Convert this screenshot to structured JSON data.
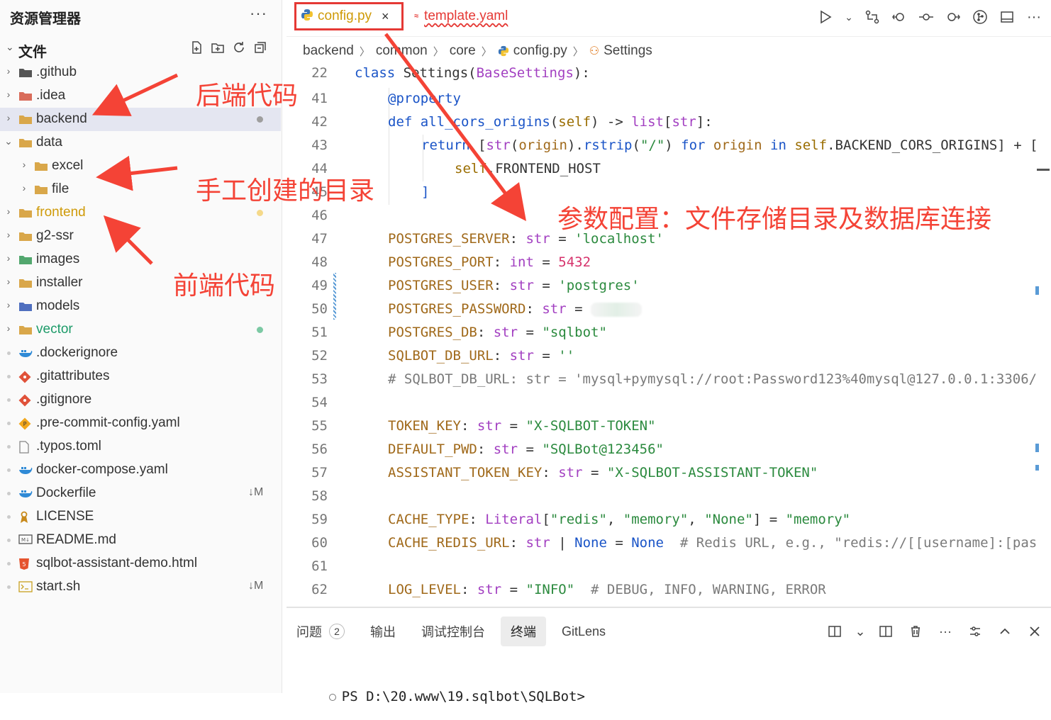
{
  "sidebar": {
    "title": "资源管理器",
    "more": "···",
    "section_title": "文件",
    "items": [
      {
        "label": "github",
        "prefix": ".",
        "kind": "folder",
        "depth": 0,
        "expanded": false,
        "color": "#333"
      },
      {
        "label": "idea",
        "prefix": ".",
        "kind": "folder",
        "depth": 0,
        "expanded": false
      },
      {
        "label": "backend",
        "kind": "folder",
        "depth": 0,
        "expanded": false,
        "selected": true,
        "dot": "#9e9e9e"
      },
      {
        "label": "data",
        "kind": "folder",
        "depth": 0,
        "expanded": true
      },
      {
        "label": "excel",
        "kind": "folder",
        "depth": 1,
        "expanded": false
      },
      {
        "label": "file",
        "kind": "folder",
        "depth": 1,
        "expanded": false
      },
      {
        "label": "frontend",
        "kind": "folder",
        "depth": 0,
        "expanded": false,
        "dot": "#f5d98a"
      },
      {
        "label": "g2-ssr",
        "kind": "folder",
        "depth": 0,
        "expanded": false
      },
      {
        "label": "images",
        "kind": "folder",
        "depth": 0,
        "expanded": false
      },
      {
        "label": "installer",
        "kind": "folder",
        "depth": 0,
        "expanded": false
      },
      {
        "label": "models",
        "kind": "folder",
        "depth": 0,
        "expanded": false
      },
      {
        "label": "vector",
        "kind": "folder",
        "depth": 0,
        "expanded": false,
        "dot": "#7cc9a4"
      },
      {
        "label": ".dockerignore",
        "kind": "docker"
      },
      {
        "label": ".gitattributes",
        "kind": "git"
      },
      {
        "label": ".gitignore",
        "kind": "git"
      },
      {
        "label": ".pre-commit-config.yaml",
        "kind": "precommit"
      },
      {
        "label": ".typos.toml",
        "kind": "file"
      },
      {
        "label": "docker-compose.yaml",
        "kind": "docker"
      },
      {
        "label": "Dockerfile",
        "kind": "docker",
        "badge": "↓M"
      },
      {
        "label": "LICENSE",
        "kind": "license"
      },
      {
        "label": "README.md",
        "kind": "md"
      },
      {
        "label": "sqlbot-assistant-demo.html",
        "kind": "html"
      },
      {
        "label": "start.sh",
        "kind": "sh",
        "badge": "↓M"
      }
    ]
  },
  "tabs": {
    "active": {
      "label": "config.py",
      "close": "×"
    },
    "second": {
      "label": "template.yaml"
    }
  },
  "breadcrumb": [
    "backend",
    "common",
    "core",
    "config.py",
    "Settings"
  ],
  "code": {
    "lines": [
      {
        "n": "22",
        "parts": [
          [
            "kw",
            "class "
          ],
          [
            "",
            "Settings"
          ],
          [
            "",
            "("
          ],
          [
            "ty",
            "BaseSettings"
          ],
          [
            "",
            "):"
          ]
        ]
      },
      {
        "n": "41",
        "indent": 1,
        "parts": [
          [
            "dec",
            "@property"
          ]
        ]
      },
      {
        "n": "42",
        "indent": 1,
        "parts": [
          [
            "kw",
            "def "
          ],
          [
            "fn",
            "all_cors_origins"
          ],
          [
            "",
            "("
          ],
          [
            "self",
            "self"
          ],
          [
            "",
            ") -> "
          ],
          [
            "ty",
            "list"
          ],
          [
            "",
            "["
          ],
          [
            "ty",
            "str"
          ],
          [
            "",
            "]:"
          ]
        ]
      },
      {
        "n": "43",
        "indent": 2,
        "parts": [
          [
            "kw",
            "return "
          ],
          [
            "",
            "["
          ],
          [
            "ty",
            "str"
          ],
          [
            "",
            "("
          ],
          [
            "var",
            "origin"
          ],
          [
            "",
            ")."
          ],
          [
            "fn",
            "rstrip"
          ],
          [
            "",
            "("
          ],
          [
            "str",
            "\"/\""
          ],
          [
            "",
            ") "
          ],
          [
            "kw",
            "for "
          ],
          [
            "var",
            "origin "
          ],
          [
            "kw",
            "in "
          ],
          [
            "self",
            "self"
          ],
          [
            "",
            ".BACKEND_CORS_ORIGINS] + ["
          ]
        ]
      },
      {
        "n": "44",
        "indent": 3,
        "parts": [
          [
            "self",
            "self"
          ],
          [
            "",
            ".FRONTEND_HOST"
          ]
        ]
      },
      {
        "n": "45",
        "indent": 2,
        "parts": [
          [
            "kw",
            "]"
          ]
        ]
      },
      {
        "n": "46",
        "parts": []
      },
      {
        "n": "47",
        "indent": 1,
        "parts": [
          [
            "var",
            "POSTGRES_SERVER"
          ],
          [
            "",
            ": "
          ],
          [
            "ty",
            "str"
          ],
          [
            "",
            " = "
          ],
          [
            "str",
            "'localhost'"
          ]
        ]
      },
      {
        "n": "48",
        "indent": 1,
        "parts": [
          [
            "var",
            "POSTGRES_PORT"
          ],
          [
            "",
            ": "
          ],
          [
            "ty",
            "int"
          ],
          [
            "",
            " = "
          ],
          [
            "num",
            "5432"
          ]
        ]
      },
      {
        "n": "49",
        "indent": 1,
        "parts": [
          [
            "var",
            "POSTGRES_USER"
          ],
          [
            "",
            ": "
          ],
          [
            "ty",
            "str"
          ],
          [
            "",
            " = "
          ],
          [
            "str",
            "'postgres'"
          ]
        ]
      },
      {
        "n": "50",
        "indent": 1,
        "blur": true,
        "parts": [
          [
            "var",
            "POSTGRES_PASSWORD"
          ],
          [
            "",
            ": "
          ],
          [
            "ty",
            "str"
          ],
          [
            "",
            " = "
          ]
        ]
      },
      {
        "n": "51",
        "indent": 1,
        "parts": [
          [
            "var",
            "POSTGRES_DB"
          ],
          [
            "",
            ": "
          ],
          [
            "ty",
            "str"
          ],
          [
            "",
            " = "
          ],
          [
            "str",
            "\"sqlbot\""
          ]
        ]
      },
      {
        "n": "52",
        "indent": 1,
        "parts": [
          [
            "var",
            "SQLBOT_DB_URL"
          ],
          [
            "",
            ": "
          ],
          [
            "ty",
            "str"
          ],
          [
            "",
            " = "
          ],
          [
            "str",
            "''"
          ]
        ]
      },
      {
        "n": "53",
        "indent": 1,
        "parts": [
          [
            "cm",
            "# SQLBOT_DB_URL: str = 'mysql+pymysql://root:Password123%40mysql@127.0.0.1:3306/"
          ]
        ]
      },
      {
        "n": "54",
        "parts": []
      },
      {
        "n": "55",
        "indent": 1,
        "parts": [
          [
            "var",
            "TOKEN_KEY"
          ],
          [
            "",
            ": "
          ],
          [
            "ty",
            "str"
          ],
          [
            "",
            " = "
          ],
          [
            "str",
            "\"X-SQLBOT-TOKEN\""
          ]
        ]
      },
      {
        "n": "56",
        "indent": 1,
        "parts": [
          [
            "var",
            "DEFAULT_PWD"
          ],
          [
            "",
            ": "
          ],
          [
            "ty",
            "str"
          ],
          [
            "",
            " = "
          ],
          [
            "str",
            "\"SQLBot@123456\""
          ]
        ]
      },
      {
        "n": "57",
        "indent": 1,
        "parts": [
          [
            "var",
            "ASSISTANT_TOKEN_KEY"
          ],
          [
            "",
            ": "
          ],
          [
            "ty",
            "str"
          ],
          [
            "",
            " = "
          ],
          [
            "str",
            "\"X-SQLBOT-ASSISTANT-TOKEN\""
          ]
        ]
      },
      {
        "n": "58",
        "parts": []
      },
      {
        "n": "59",
        "indent": 1,
        "parts": [
          [
            "var",
            "CACHE_TYPE"
          ],
          [
            "",
            ": "
          ],
          [
            "ty",
            "Literal"
          ],
          [
            "",
            "["
          ],
          [
            "str",
            "\"redis\""
          ],
          [
            "",
            ", "
          ],
          [
            "str",
            "\"memory\""
          ],
          [
            "",
            ", "
          ],
          [
            "str",
            "\"None\""
          ],
          [
            "",
            "]"
          ],
          [
            "",
            " = "
          ],
          [
            "str",
            "\"memory\""
          ]
        ]
      },
      {
        "n": "60",
        "indent": 1,
        "parts": [
          [
            "var",
            "CACHE_REDIS_URL"
          ],
          [
            "",
            ": "
          ],
          [
            "ty",
            "str"
          ],
          [
            "",
            " | "
          ],
          [
            "kw",
            "None"
          ],
          [
            "",
            " = "
          ],
          [
            "kw",
            "None"
          ],
          [
            "cm",
            "  # Redis URL, e.g., \"redis://[[username]:[pas"
          ]
        ]
      },
      {
        "n": "61",
        "parts": []
      },
      {
        "n": "62",
        "indent": 1,
        "parts": [
          [
            "var",
            "LOG_LEVEL"
          ],
          [
            "",
            ": "
          ],
          [
            "ty",
            "str"
          ],
          [
            "",
            " = "
          ],
          [
            "str",
            "\"INFO\""
          ],
          [
            "cm",
            "  # DEBUG, INFO, WARNING, ERROR"
          ]
        ]
      }
    ]
  },
  "panel": {
    "tabs": [
      {
        "label": "问题",
        "badge": "2"
      },
      {
        "label": "输出"
      },
      {
        "label": "调试控制台"
      },
      {
        "label": "终端",
        "active": true
      },
      {
        "label": "GitLens"
      }
    ],
    "terminal_prompt": "PS D:\\20.www\\19.sqlbot\\SQLBot>"
  },
  "annotations": {
    "backend": "后端代码",
    "data": "手工创建的目录",
    "frontend": "前端代码",
    "config": "参数配置：文件存储目录及数据库连接"
  },
  "colors": {
    "annotation": "#f44336",
    "selected_row": "#e4e6f1"
  }
}
